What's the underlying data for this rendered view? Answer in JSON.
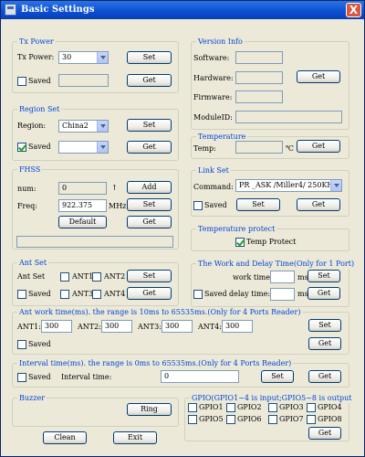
{
  "window": {
    "title": "Basic Settings",
    "close": "X"
  },
  "tx_power": {
    "group": "Tx Power",
    "tx_label": "Tx Power:",
    "tx_value": "30",
    "set": "Set",
    "saved": "Saved",
    "get": "Get"
  },
  "version": {
    "group": "Version Info",
    "software": "Software:",
    "hardware": "Hardware:",
    "firmware": "Firmware:",
    "module_id": "ModuleID:",
    "get": "Get"
  },
  "region": {
    "group": "Region Set",
    "region_label": "Region:",
    "region_value": "China2",
    "set": "Set",
    "saved": "Saved",
    "get": "Get"
  },
  "temperature": {
    "group": "Temperature",
    "temp_label": "Temp:",
    "unit": "℃",
    "get": "Get"
  },
  "fhss": {
    "group": "FHSS",
    "num_label": "num:",
    "num_value": "0",
    "arrow": "↑",
    "add": "Add",
    "freq_label": "Freq:",
    "freq_value": "922.375",
    "freq_unit": "MHz",
    "set": "Set",
    "default": "Default",
    "get": "Get"
  },
  "link": {
    "group": "Link Set",
    "command_label": "Command:",
    "command_value": "PR _ASK /Miller4/ 250KHz",
    "saved": "Saved",
    "set": "Set",
    "get": "Get"
  },
  "temp_protect": {
    "group": "Temperature protect",
    "label": "Temp Protect"
  },
  "ant": {
    "group": "Ant Set",
    "ant_set": "Ant Set",
    "ant1": "ANT1",
    "ant2": "ANT2",
    "ant3": "ANT3",
    "ant4": "ANT4",
    "saved": "Saved",
    "set": "Set",
    "get": "Get"
  },
  "work_delay": {
    "group": "The Work and Delay Time(Only for 1 Port)",
    "work_label": "work time:",
    "ms1": "ms",
    "set": "Set",
    "saved": "Saved",
    "delay_label": "delay time:",
    "ms2": "ms",
    "get": "Get"
  },
  "ant_work": {
    "group": "Ant work time(ms). the range is 10ms to 65535ms.(Only for 4 Ports Reader)",
    "ant1": "ANT1:",
    "ant1_value": "300",
    "ant2": "ANT2:",
    "ant2_value": "300",
    "ant3": "ANT3:",
    "ant3_value": "300",
    "ant4": "ANT4:",
    "ant4_value": "300",
    "set": "Set",
    "saved": "Saved",
    "get": "Get"
  },
  "interval": {
    "group": "Interval time(ms). the range is 0ms to 65535ms.(Only for 4 Ports Reader)",
    "saved": "Saved",
    "interval_label": "Interval time:",
    "interval_value": "0",
    "set": "Set",
    "get": "Get"
  },
  "buzzer": {
    "group": "Buzzer",
    "ring": "Ring"
  },
  "gpio": {
    "group": "GPIO(GPIO1~4 is input;GPIO5~8 is output",
    "items": [
      "GPIO1",
      "GPIO2",
      "GPIO3",
      "GPIO4",
      "GPIO5",
      "GPIO6",
      "GPIO7",
      "GPIO8"
    ],
    "get": "Get"
  },
  "footer": {
    "clean": "Clean",
    "exit": "Exit"
  }
}
